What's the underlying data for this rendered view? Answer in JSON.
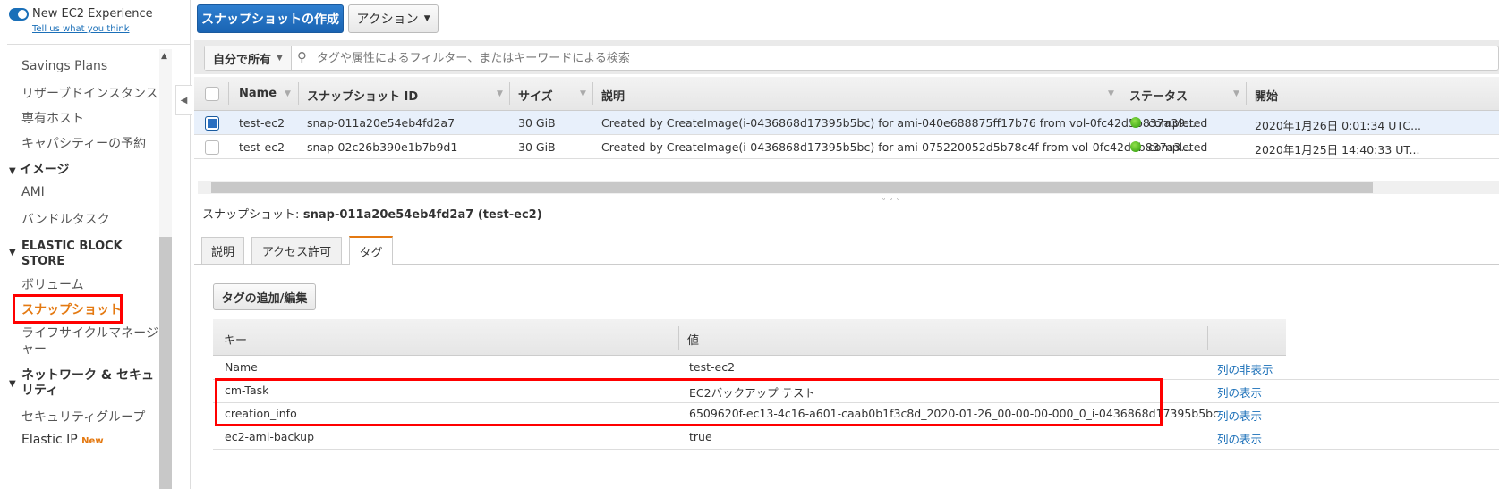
{
  "sidebar": {
    "experience_label": "New EC2 Experience",
    "feedback_link": "Tell us what you think",
    "items": [
      "Savings Plans",
      "リザーブドインスタンス",
      "専有ホスト",
      "キャパシティーの予約"
    ],
    "images_header": "イメージ",
    "images_items": [
      "AMI",
      "バンドルタスク"
    ],
    "ebs_header_1": "ELASTIC BLOCK",
    "ebs_header_2": "STORE",
    "ebs_items": [
      "ボリューム",
      "スナップショット",
      "ライフサイクルマネージャー"
    ],
    "lifecycle_1": "ライフサイクルマネージ",
    "lifecycle_2": "ャー",
    "network_header_1": "ネットワーク & セキュ",
    "network_header_2": "リティ",
    "network_items": [
      "セキュリティグループ",
      "Elastic IP"
    ],
    "new_badge": "New"
  },
  "toolbar": {
    "create_label": "スナップショットの作成",
    "actions_label": "アクション"
  },
  "filter": {
    "owner_label": "自分で所有",
    "placeholder": "タグや属性によるフィルター、またはキーワードによる検索"
  },
  "table": {
    "headers": [
      "Name",
      "スナップショット ID",
      "サイズ",
      "説明",
      "ステータス",
      "開始"
    ],
    "rows": [
      {
        "name": "test-ec2",
        "id": "snap-011a20e54eb4fd2a7",
        "size": "30 GiB",
        "desc": "Created by CreateImage(i-0436868d17395b5bc) for ami-040e688875ff17b76 from vol-0fc42d5b837a39...",
        "status": "completed",
        "started": "2020年1月26日 0:01:34 UTC...",
        "selected": true
      },
      {
        "name": "test-ec2",
        "id": "snap-02c26b390e1b7b9d1",
        "size": "30 GiB",
        "desc": "Created by CreateImage(i-0436868d17395b5bc) for ami-075220052d5b78c4f from vol-0fc42d5b837a3...",
        "status": "completed",
        "started": "2020年1月25日 14:40:33 UT...",
        "selected": false
      }
    ]
  },
  "detail": {
    "title_prefix": "スナップショット:",
    "title_value": "snap-011a20e54eb4fd2a7 (test-ec2)",
    "tabs": [
      "説明",
      "アクセス許可",
      "タグ"
    ],
    "add_tag_label": "タグの追加/編集",
    "tag_headers": [
      "キー",
      "値"
    ],
    "tags": [
      {
        "key": "Name",
        "value": "test-ec2",
        "action": "列の非表示"
      },
      {
        "key": "cm-Task",
        "value": "EC2バックアップ テスト",
        "action": "列の表示"
      },
      {
        "key": "creation_info",
        "value": "6509620f-ec13-4c16-a601-caab0b1f3c8d_2020-01-26_00-00-00-000_0_i-0436868d17395b5bc",
        "action": "列の表示"
      },
      {
        "key": "ec2-ami-backup",
        "value": "true",
        "action": "列の表示"
      }
    ]
  },
  "colors": {
    "primary": "#1a6fb8",
    "highlight": "#ff0000",
    "active": "#e47911"
  }
}
